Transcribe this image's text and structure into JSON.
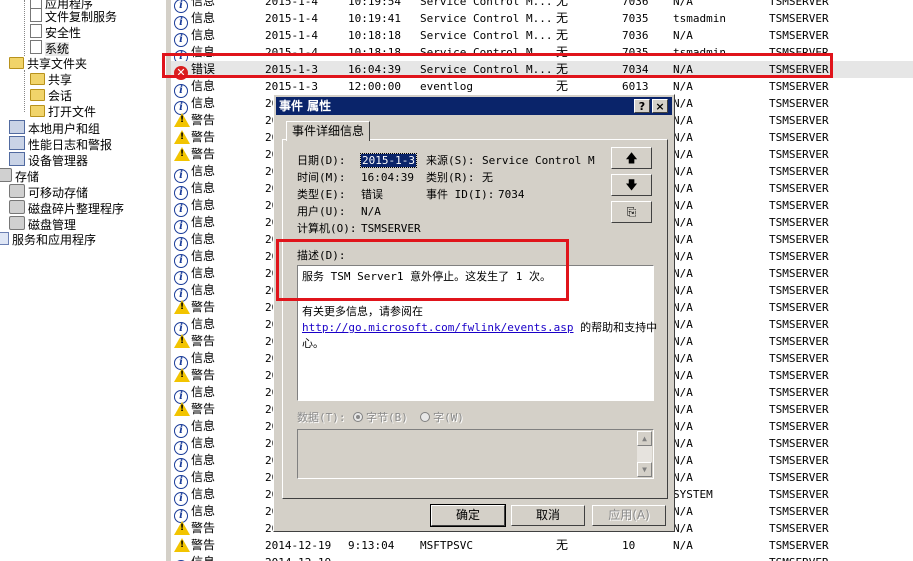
{
  "tree": [
    {
      "label": "应用程序",
      "icon": "event-log-icon"
    },
    {
      "label": "文件复制服务",
      "icon": "event-log-icon"
    },
    {
      "label": "安全性",
      "icon": "event-log-icon"
    },
    {
      "label": "系统",
      "icon": "event-log-icon"
    },
    {
      "label": "共享文件夹",
      "icon": "folder-icon"
    },
    {
      "label": "共享",
      "icon": "folder-icon"
    },
    {
      "label": "会话",
      "icon": "folder-icon"
    },
    {
      "label": "打开文件",
      "icon": "folder-icon"
    },
    {
      "label": "本地用户和组",
      "icon": "users-icon"
    },
    {
      "label": "性能日志和警报",
      "icon": "performance-icon"
    },
    {
      "label": "设备管理器",
      "icon": "device-manager-icon"
    },
    {
      "label": "存储",
      "icon": "storage-icon"
    },
    {
      "label": "可移动存储",
      "icon": "removable-storage-icon"
    },
    {
      "label": "磁盘碎片整理程序",
      "icon": "defrag-icon"
    },
    {
      "label": "磁盘管理",
      "icon": "disk-management-icon"
    },
    {
      "label": "服务和应用程序",
      "icon": "services-icon"
    }
  ],
  "events": [
    {
      "type": "信息",
      "kind": "info",
      "date": "2015-1-4",
      "time": "10:19:54",
      "source": "Service Control M...",
      "category": "无",
      "id": "7036",
      "user": "N/A",
      "computer": "TSMSERVER"
    },
    {
      "type": "信息",
      "kind": "info",
      "date": "2015-1-4",
      "time": "10:19:41",
      "source": "Service Control M...",
      "category": "无",
      "id": "7035",
      "user": "tsmadmin",
      "computer": "TSMSERVER"
    },
    {
      "type": "信息",
      "kind": "info",
      "date": "2015-1-4",
      "time": "10:18:18",
      "source": "Service Control M...",
      "category": "无",
      "id": "7036",
      "user": "N/A",
      "computer": "TSMSERVER"
    },
    {
      "type": "信息",
      "kind": "info",
      "date": "2015-1-4",
      "time": "10:18:18",
      "source": "Service Control M...",
      "category": "无",
      "id": "7035",
      "user": "tsmadmin",
      "computer": "TSMSERVER"
    },
    {
      "type": "错误",
      "kind": "error",
      "date": "2015-1-3",
      "time": "16:04:39",
      "source": "Service Control M...",
      "category": "无",
      "id": "7034",
      "user": "N/A",
      "computer": "TSMSERVER",
      "selected": true
    },
    {
      "type": "信息",
      "kind": "info",
      "date": "2015-1-3",
      "time": "12:00:00",
      "source": "eventlog",
      "category": "无",
      "id": "6013",
      "user": "N/A",
      "computer": "TSMSERVER"
    },
    {
      "type": "信息",
      "kind": "info",
      "date": "20",
      "time": "",
      "source": "",
      "category": "",
      "id": "",
      "user": "N/A",
      "computer": "TSMSERVER"
    },
    {
      "type": "警告",
      "kind": "warn",
      "date": "20",
      "time": "",
      "source": "",
      "category": "",
      "id": "",
      "user": "N/A",
      "computer": "TSMSERVER"
    },
    {
      "type": "警告",
      "kind": "warn",
      "date": "20",
      "time": "",
      "source": "",
      "category": "",
      "id": "",
      "user": "N/A",
      "computer": "TSMSERVER"
    },
    {
      "type": "警告",
      "kind": "warn",
      "date": "20",
      "time": "",
      "source": "",
      "category": "",
      "id": "",
      "user": "N/A",
      "computer": "TSMSERVER"
    },
    {
      "type": "信息",
      "kind": "info",
      "date": "20",
      "time": "",
      "source": "",
      "category": "",
      "id": "",
      "user": "N/A",
      "computer": "TSMSERVER"
    },
    {
      "type": "信息",
      "kind": "info",
      "date": "20",
      "time": "",
      "source": "",
      "category": "",
      "id": "",
      "user": "N/A",
      "computer": "TSMSERVER"
    },
    {
      "type": "信息",
      "kind": "info",
      "date": "20",
      "time": "",
      "source": "",
      "category": "",
      "id": "",
      "user": "N/A",
      "computer": "TSMSERVER"
    },
    {
      "type": "信息",
      "kind": "info",
      "date": "20",
      "time": "",
      "source": "",
      "category": "",
      "id": "",
      "user": "N/A",
      "computer": "TSMSERVER"
    },
    {
      "type": "信息",
      "kind": "info",
      "date": "20",
      "time": "",
      "source": "",
      "category": "",
      "id": "",
      "user": "N/A",
      "computer": "TSMSERVER"
    },
    {
      "type": "信息",
      "kind": "info",
      "date": "20",
      "time": "",
      "source": "",
      "category": "",
      "id": "",
      "user": "N/A",
      "computer": "TSMSERVER"
    },
    {
      "type": "信息",
      "kind": "info",
      "date": "20",
      "time": "",
      "source": "",
      "category": "",
      "id": "",
      "user": "N/A",
      "computer": "TSMSERVER"
    },
    {
      "type": "信息",
      "kind": "info",
      "date": "20",
      "time": "",
      "source": "",
      "category": "",
      "id": "",
      "user": "N/A",
      "computer": "TSMSERVER"
    },
    {
      "type": "警告",
      "kind": "warn",
      "date": "20",
      "time": "",
      "source": "",
      "category": "",
      "id": "",
      "user": "N/A",
      "computer": "TSMSERVER"
    },
    {
      "type": "信息",
      "kind": "info",
      "date": "20",
      "time": "",
      "source": "",
      "category": "",
      "id": "",
      "user": "N/A",
      "computer": "TSMSERVER"
    },
    {
      "type": "警告",
      "kind": "warn",
      "date": "20",
      "time": "",
      "source": "",
      "category": "",
      "id": "",
      "user": "N/A",
      "computer": "TSMSERVER"
    },
    {
      "type": "信息",
      "kind": "info",
      "date": "20",
      "time": "",
      "source": "",
      "category": "",
      "id": "",
      "user": "N/A",
      "computer": "TSMSERVER"
    },
    {
      "type": "警告",
      "kind": "warn",
      "date": "20",
      "time": "",
      "source": "",
      "category": "",
      "id": "",
      "user": "N/A",
      "computer": "TSMSERVER"
    },
    {
      "type": "信息",
      "kind": "info",
      "date": "20",
      "time": "",
      "source": "",
      "category": "",
      "id": "",
      "user": "N/A",
      "computer": "TSMSERVER"
    },
    {
      "type": "警告",
      "kind": "warn",
      "date": "20",
      "time": "",
      "source": "",
      "category": "",
      "id": "",
      "user": "N/A",
      "computer": "TSMSERVER"
    },
    {
      "type": "信息",
      "kind": "info",
      "date": "20",
      "time": "",
      "source": "",
      "category": "",
      "id": "",
      "user": "N/A",
      "computer": "TSMSERVER"
    },
    {
      "type": "信息",
      "kind": "info",
      "date": "20",
      "time": "",
      "source": "",
      "category": "",
      "id": "",
      "user": "N/A",
      "computer": "TSMSERVER"
    },
    {
      "type": "信息",
      "kind": "info",
      "date": "20",
      "time": "",
      "source": "",
      "category": "",
      "id": "",
      "user": "N/A",
      "computer": "TSMSERVER"
    },
    {
      "type": "信息",
      "kind": "info",
      "date": "20",
      "time": "",
      "source": "",
      "category": "",
      "id": "",
      "user": "N/A",
      "computer": "TSMSERVER"
    },
    {
      "type": "信息",
      "kind": "info",
      "date": "20",
      "time": "",
      "source": "",
      "category": "",
      "id": "",
      "user": "SYSTEM",
      "computer": "TSMSERVER"
    },
    {
      "type": "信息",
      "kind": "info",
      "date": "20",
      "time": "",
      "source": "",
      "category": "",
      "id": "",
      "user": "N/A",
      "computer": "TSMSERVER"
    },
    {
      "type": "警告",
      "kind": "warn",
      "date": "20",
      "time": "",
      "source": "",
      "category": "",
      "id": "",
      "user": "N/A",
      "computer": "TSMSERVER"
    },
    {
      "type": "警告",
      "kind": "warn",
      "date": "2014-12-19",
      "time": "9:13:04",
      "source": "MSFTPSVC",
      "category": "无",
      "id": "10",
      "user": "N/A",
      "computer": "TSMSERVER"
    },
    {
      "type": "信息",
      "kind": "info",
      "date": "2014-12-19",
      "time": "",
      "source": "",
      "category": "",
      "id": "",
      "user": "",
      "computer": "TSMSERVER"
    }
  ],
  "dialog": {
    "title": "事件 属性",
    "help_glyph": "?",
    "close_glyph": "×",
    "tab": "事件详细信息",
    "date_label": "日期(D):",
    "date_value": "2015-1-3",
    "source_label": "来源(S):",
    "source_value": "Service Control M",
    "time_label": "时间(M):",
    "time_value": "16:04:39",
    "category_label": "类别(R):",
    "category_value": "无",
    "type_label": "类型(E):",
    "type_value": "错误",
    "eventid_label": "事件 ID(I):",
    "eventid_value": "7034",
    "user_label": "用户(U):",
    "user_value": "N/A",
    "computer_label": "计算机(O):",
    "computer_value": "TSMSERVER",
    "desc_label": "描述(D):",
    "description": "服务 TSM Server1 意外停止。这发生了 1 次。",
    "more_info": "有关更多信息，请参阅在",
    "link": "http://go.microsoft.com/fwlink/events.asp",
    "link_suffix": "的帮助和支持中",
    "link_suffix2": "心。",
    "data_label": "数据(T):",
    "bytes_option": "字节(B)",
    "words_option": "字(W)",
    "up_glyph": "🡅",
    "down_glyph": "🡇",
    "copy_glyph": "⎘",
    "scroll_up": "▲",
    "scroll_down": "▼",
    "ok": "确定",
    "cancel": "取消",
    "apply": "应用(A)"
  },
  "icon_glyphs": {
    "info": "i",
    "error": "✕",
    "warn": "!"
  },
  "colors": {
    "title_bar": "#0a246a",
    "highlight": "#e0141b",
    "dialog_bg": "#d4d0c8",
    "link": "#1a00c8"
  }
}
